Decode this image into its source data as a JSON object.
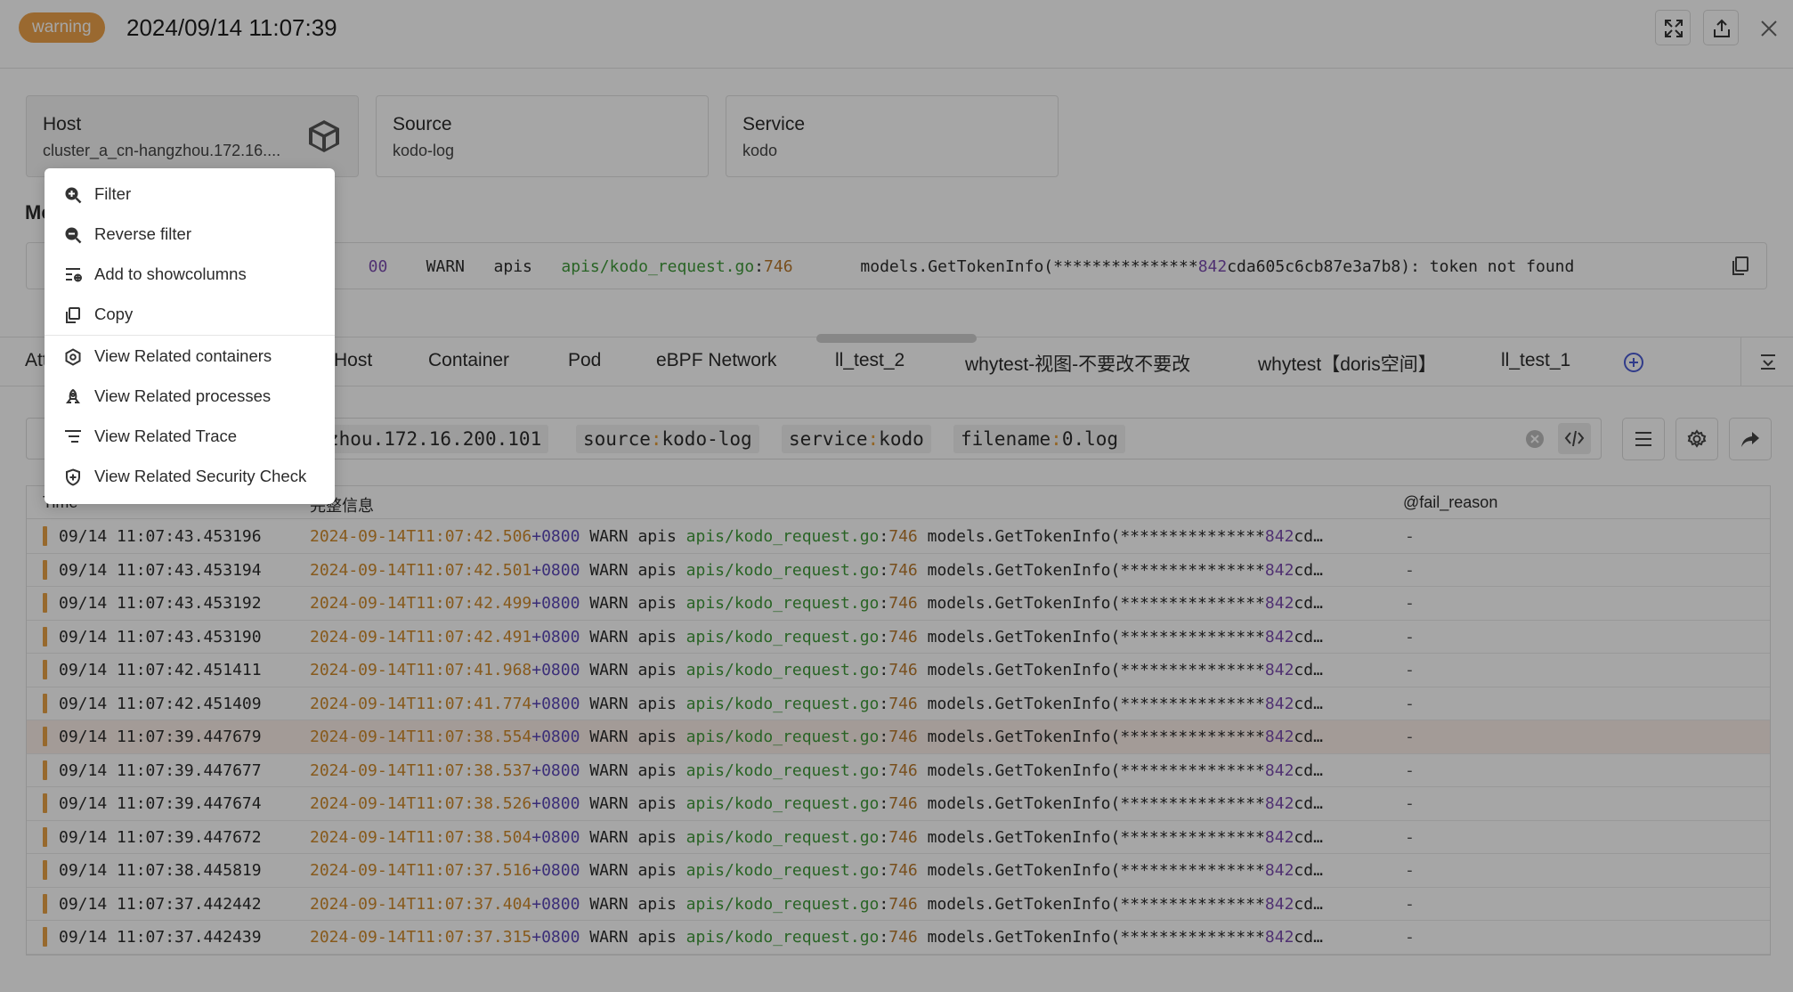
{
  "header": {
    "badge": "warning",
    "title": "2024/09/14 11:07:39"
  },
  "cards": [
    {
      "label": "Host",
      "value": "cluster_a_cn-hangzhou.172.16...."
    },
    {
      "label": "Source",
      "value": "kodo-log"
    },
    {
      "label": "Service",
      "value": "kodo"
    }
  ],
  "message": {
    "heading": "Me",
    "fragment": "　",
    "line_prefix": "00",
    "level": "WARN",
    "module": "apis",
    "file": "apis/kodo_request.go",
    "colon": ":",
    "line_no": "746",
    "text_start": "models.GetTokenInfo(***************",
    "text_num": "842",
    "text_end": "cda605c6cb87e3a7b8): token not found"
  },
  "tabs": [
    "Att",
    "Host",
    "Container",
    "Pod",
    "eBPF Network",
    "ll_test_2",
    "whytest-视图-不要改不要改",
    "whytest【doris空间】",
    "ll_test_1"
  ],
  "search": {
    "chip_host": "zhou.172.16.200.101",
    "chips": [
      {
        "key": "source",
        "sep": ":",
        "value": "kodo-log"
      },
      {
        "key": "service",
        "sep": ":",
        "value": "kodo"
      },
      {
        "key": "filename",
        "sep": ":",
        "value": "0.log"
      }
    ]
  },
  "table": {
    "headers": {
      "time": "Time",
      "message": "完整信息",
      "fail_reason": "@fail_reason"
    },
    "msg_parts": {
      "plus": "+0800",
      "level": " WARN apis ",
      "file": "apis/kodo_request.go",
      "colon": ":",
      "line": "746",
      "text": " models.GetTokenInfo(***************",
      "num": "842",
      "tail": "cd…"
    },
    "rows": [
      {
        "time": "09/14 11:07:43.453196",
        "ts": "2024-09-14T11:07:42.506",
        "fail": "-"
      },
      {
        "time": "09/14 11:07:43.453194",
        "ts": "2024-09-14T11:07:42.501",
        "fail": "-"
      },
      {
        "time": "09/14 11:07:43.453192",
        "ts": "2024-09-14T11:07:42.499",
        "fail": "-"
      },
      {
        "time": "09/14 11:07:43.453190",
        "ts": "2024-09-14T11:07:42.491",
        "fail": "-"
      },
      {
        "time": "09/14 11:07:42.451411",
        "ts": "2024-09-14T11:07:41.968",
        "fail": "-"
      },
      {
        "time": "09/14 11:07:42.451409",
        "ts": "2024-09-14T11:07:41.774",
        "fail": "-"
      },
      {
        "time": "09/14 11:07:39.447679",
        "ts": "2024-09-14T11:07:38.554",
        "fail": "-",
        "selected": true
      },
      {
        "time": "09/14 11:07:39.447677",
        "ts": "2024-09-14T11:07:38.537",
        "fail": "-"
      },
      {
        "time": "09/14 11:07:39.447674",
        "ts": "2024-09-14T11:07:38.526",
        "fail": "-"
      },
      {
        "time": "09/14 11:07:39.447672",
        "ts": "2024-09-14T11:07:38.504",
        "fail": "-"
      },
      {
        "time": "09/14 11:07:38.445819",
        "ts": "2024-09-14T11:07:37.516",
        "fail": "-"
      },
      {
        "time": "09/14 11:07:37.442442",
        "ts": "2024-09-14T11:07:37.404",
        "fail": "-"
      },
      {
        "time": "09/14 11:07:37.442439",
        "ts": "2024-09-14T11:07:37.315",
        "fail": "-"
      }
    ]
  },
  "context_menu": [
    {
      "label": "Filter",
      "icon": "zoom-in-icon"
    },
    {
      "label": "Reverse filter",
      "icon": "zoom-out-icon"
    },
    {
      "label": "Add to showcolumns",
      "icon": "add-column-icon"
    },
    {
      "label": "Copy",
      "icon": "copy-icon"
    },
    {
      "label": "View Related containers",
      "icon": "container-icon"
    },
    {
      "label": "View Related processes",
      "icon": "process-icon"
    },
    {
      "label": "View Related Trace",
      "icon": "trace-icon"
    },
    {
      "label": "View Related Security Check",
      "icon": "shield-icon"
    }
  ],
  "colors": {
    "badge": "#eda24a",
    "timestamp": "#d08a2c",
    "file": "#3f9a3a",
    "number": "#7b4cb0",
    "selected_row": "#fbeee8"
  }
}
